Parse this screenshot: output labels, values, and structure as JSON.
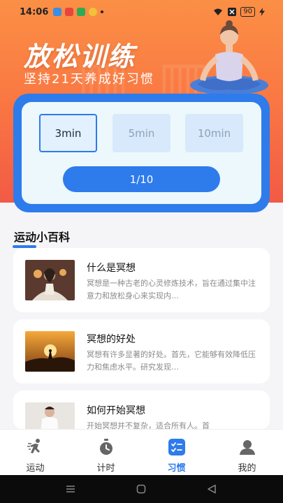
{
  "status_bar": {
    "time": "14:06",
    "battery": "90"
  },
  "hero": {
    "title": "放松训练",
    "subtitle": "坚持21天养成好习惯",
    "colors": {
      "top": "#fb8f45",
      "bottom": "#f25a45",
      "accent": "#2e7bec"
    }
  },
  "timer_card": {
    "options": [
      {
        "label": "3min",
        "selected": true
      },
      {
        "label": "5min",
        "selected": false
      },
      {
        "label": "10min",
        "selected": false
      }
    ],
    "progress_label": "1/10"
  },
  "encyclopedia": {
    "title": "运动小百科",
    "articles": [
      {
        "title": "什么是冥想",
        "desc": "冥想是一种古老的心灵修炼技术，旨在通过集中注意力和放松身心来实现内…"
      },
      {
        "title": "冥想的好处",
        "desc": "冥想有许多显著的好处。首先，它能够有效降低压力和焦虑水平。研究发现…"
      },
      {
        "title": "如何开始冥想",
        "desc": "开始冥想并不复杂，适合所有人。首"
      }
    ]
  },
  "tabbar": {
    "items": [
      {
        "label": "运动",
        "icon": "running-icon",
        "active": false
      },
      {
        "label": "计时",
        "icon": "stopwatch-icon",
        "active": false
      },
      {
        "label": "习惯",
        "icon": "checklist-icon",
        "active": true
      },
      {
        "label": "我的",
        "icon": "profile-icon",
        "active": false
      }
    ]
  }
}
